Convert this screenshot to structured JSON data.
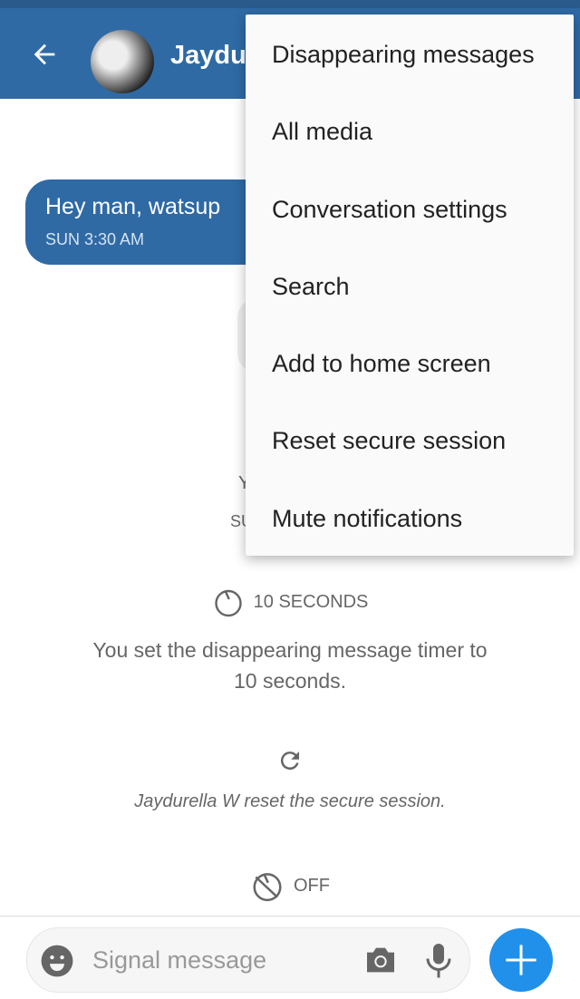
{
  "header": {
    "title": "Jaydu",
    "back_icon": "arrow-left-icon",
    "avatar": "contact-avatar"
  },
  "messages": [
    {
      "text": "Hey man, watsup",
      "time": "SUN 3:30 AM",
      "direction": "incoming"
    }
  ],
  "occluded_fragments": [
    "Y",
    "SU"
  ],
  "events": {
    "timer_label": "10 SECONDS",
    "timer_text": "You set the disappearing message timer to 10 seconds.",
    "reset_text": "Jaydurella W reset the secure session.",
    "off_label": "OFF"
  },
  "menu": {
    "items": [
      {
        "label": "Disappearing messages"
      },
      {
        "label": "All media"
      },
      {
        "label": "Conversation settings"
      },
      {
        "label": "Search"
      },
      {
        "label": "Add to home screen"
      },
      {
        "label": "Reset secure session"
      },
      {
        "label": "Mute notifications"
      }
    ]
  },
  "composer": {
    "placeholder": "Signal message",
    "value": ""
  },
  "colors": {
    "appbar": "#2f6aa5",
    "accent": "#2090ea",
    "bubble": "#2f6aa5"
  }
}
